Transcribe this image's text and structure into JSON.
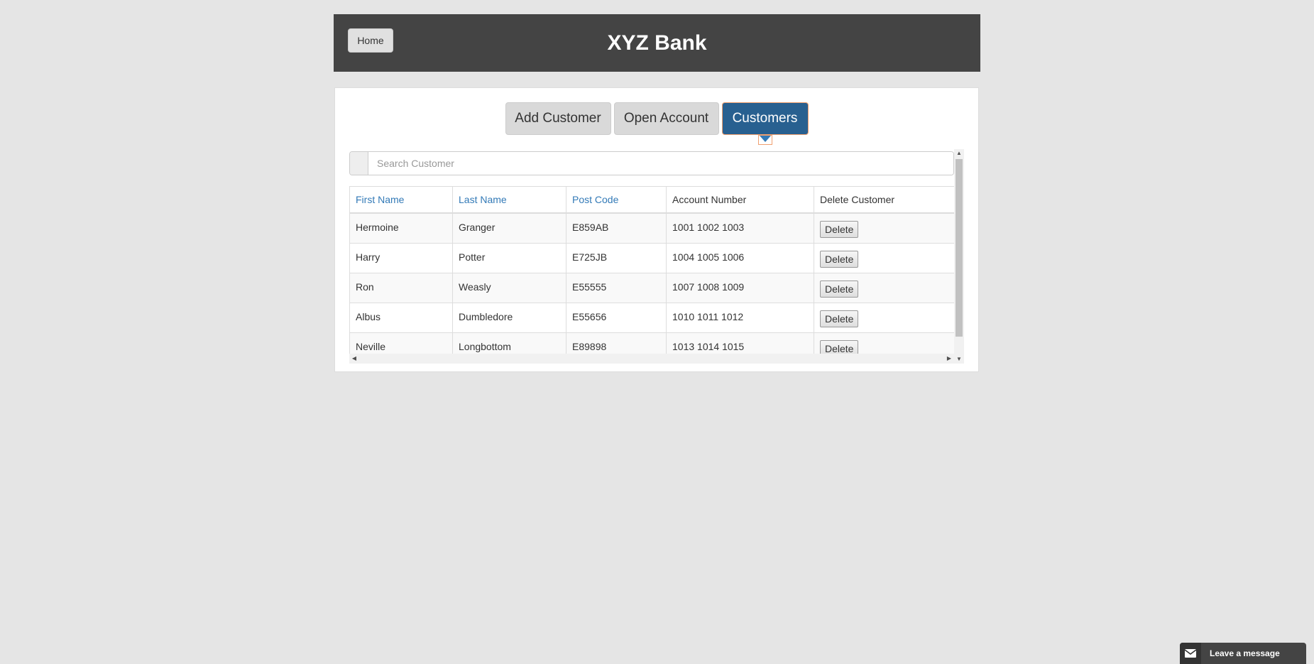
{
  "header": {
    "home_label": "Home",
    "title": "XYZ Bank"
  },
  "tabs": [
    {
      "label": "Add Customer",
      "active": false
    },
    {
      "label": "Open Account",
      "active": false
    },
    {
      "label": "Customers",
      "active": true
    }
  ],
  "search": {
    "placeholder": "Search Customer",
    "value": ""
  },
  "table": {
    "columns": [
      "First Name",
      "Last Name",
      "Post Code",
      "Account Number",
      "Delete Customer"
    ],
    "rows": [
      {
        "first": "Hermoine",
        "last": "Granger",
        "post": "E859AB",
        "accounts": "1001 1002 1003",
        "action": "Delete"
      },
      {
        "first": "Harry",
        "last": "Potter",
        "post": "E725JB",
        "accounts": "1004 1005 1006",
        "action": "Delete"
      },
      {
        "first": "Ron",
        "last": "Weasly",
        "post": "E55555",
        "accounts": "1007 1008 1009",
        "action": "Delete"
      },
      {
        "first": "Albus",
        "last": "Dumbledore",
        "post": "E55656",
        "accounts": "1010 1011 1012",
        "action": "Delete"
      },
      {
        "first": "Neville",
        "last": "Longbottom",
        "post": "E89898",
        "accounts": "1013 1014 1015",
        "action": "Delete"
      }
    ]
  },
  "chat": {
    "label": "Leave a message",
    "icon": "envelope-icon"
  },
  "colors": {
    "header_bg": "#444444",
    "active_tab": "#286090",
    "link": "#337ab7",
    "page_bg": "#e5e5e5"
  }
}
